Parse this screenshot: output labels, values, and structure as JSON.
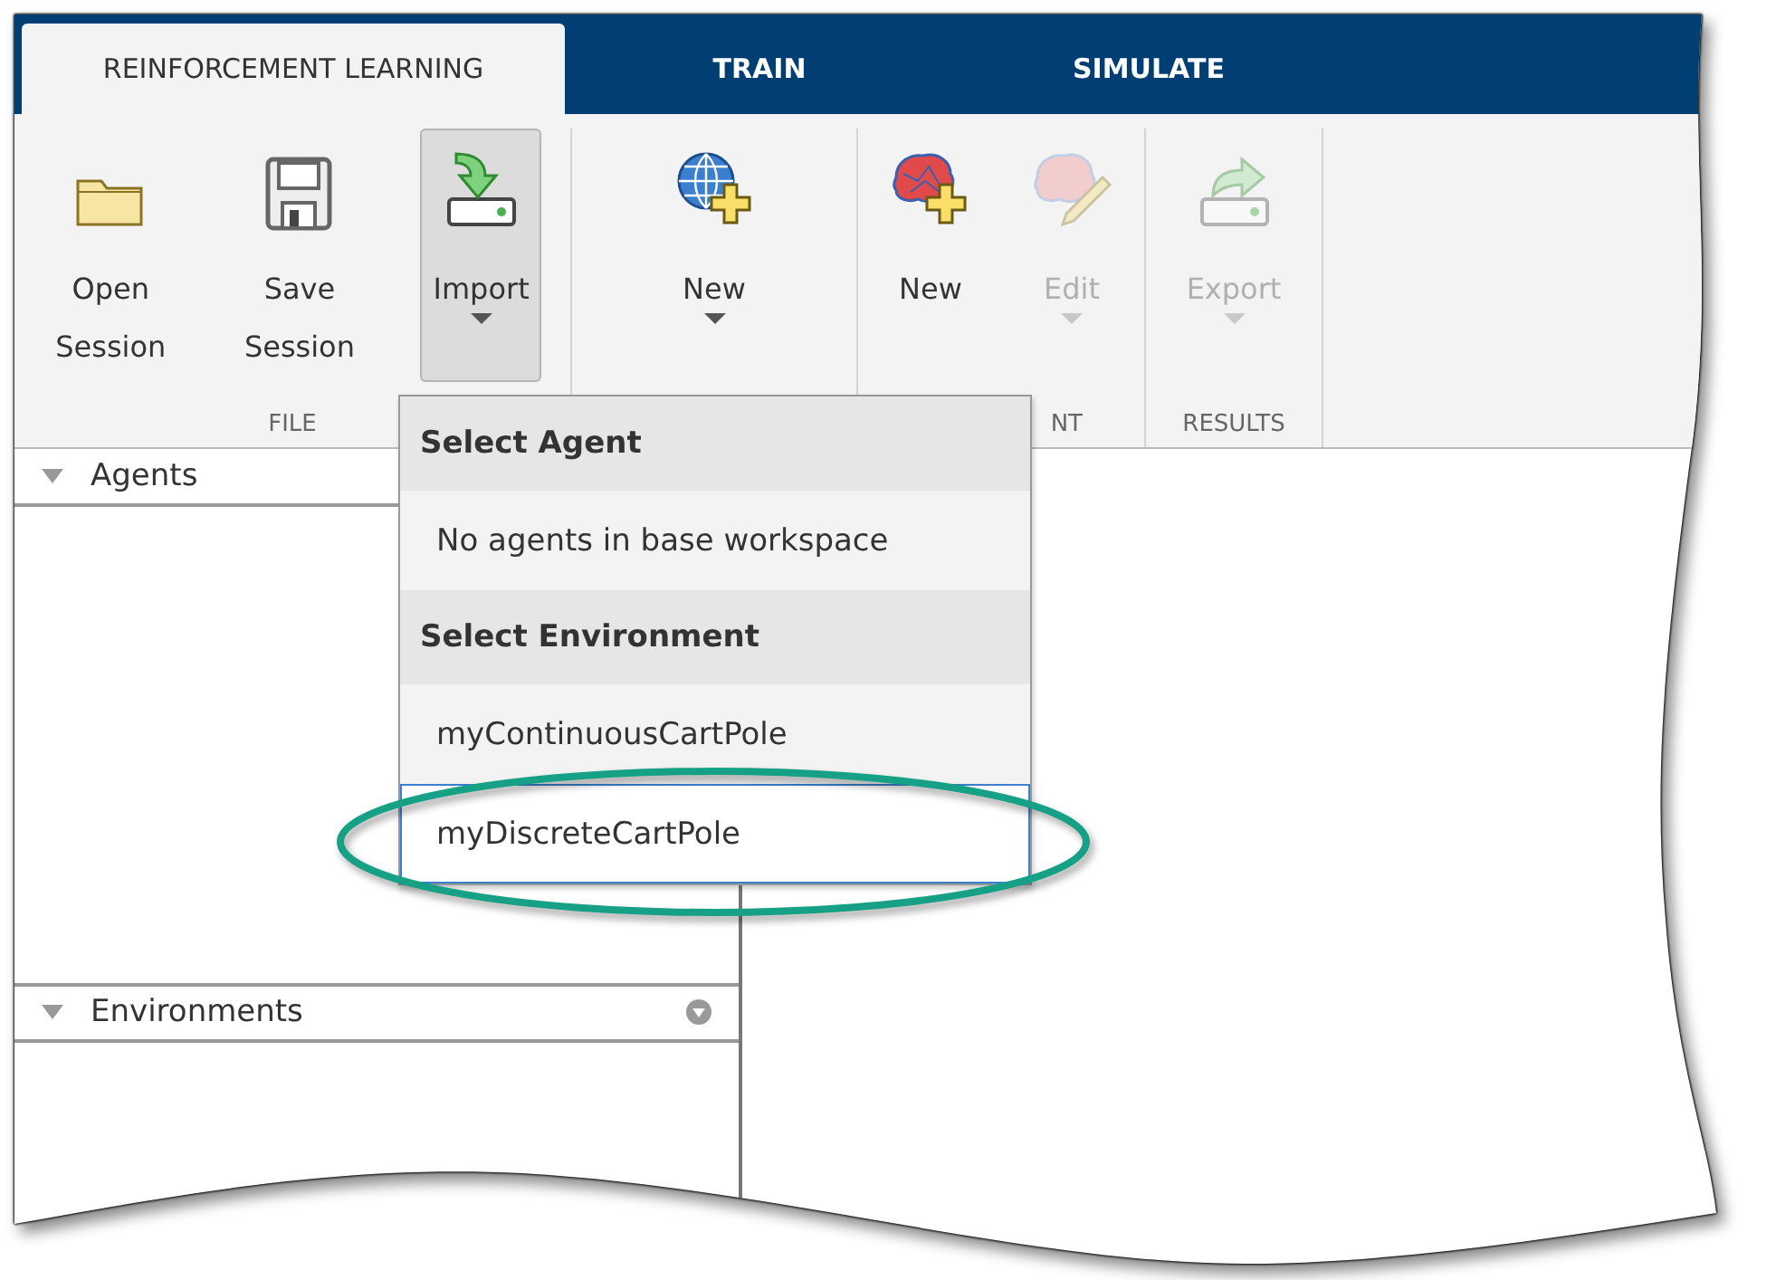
{
  "tabs": [
    {
      "label": "REINFORCEMENT LEARNING",
      "selected": true
    },
    {
      "label": "TRAIN",
      "selected": false
    },
    {
      "label": "SIMULATE",
      "selected": false
    }
  ],
  "sections": [
    {
      "label": "FILE",
      "buttons": [
        {
          "kind": "open",
          "label": "Open Session",
          "disabled": false,
          "pressed": false,
          "dropdown": false
        },
        {
          "kind": "save",
          "label": "Save Session",
          "disabled": false,
          "pressed": false,
          "dropdown": false
        },
        {
          "kind": "import",
          "label": "Import",
          "disabled": false,
          "pressed": true,
          "dropdown": true
        }
      ]
    },
    {
      "buttons": [
        {
          "kind": "new_environment",
          "label": "New",
          "disabled": false,
          "pressed": false,
          "dropdown": true
        }
      ]
    },
    {
      "label": "NT",
      "buttons": [
        {
          "kind": "new_agent",
          "label": "New",
          "disabled": false,
          "pressed": false,
          "dropdown": false
        },
        {
          "kind": "edit",
          "label": "Edit",
          "disabled": true,
          "pressed": false,
          "dropdown": true
        }
      ]
    },
    {
      "label": "RESULTS",
      "buttons": [
        {
          "kind": "export",
          "label": "Export",
          "disabled": true,
          "pressed": false,
          "dropdown": true
        }
      ]
    }
  ],
  "panels": [
    {
      "title": "Agents"
    },
    {
      "title": "Environments",
      "menu_button": true
    }
  ],
  "import_menu": [
    {
      "kind": "header",
      "text": "Select Agent"
    },
    {
      "kind": "item",
      "text": "No agents in base workspace",
      "selected": false
    },
    {
      "kind": "header",
      "text": "Select Environment"
    },
    {
      "kind": "item",
      "text": "myContinuousCartPole",
      "selected": false
    },
    {
      "kind": "item",
      "text": "myDiscreteCartPole",
      "selected": true
    }
  ]
}
